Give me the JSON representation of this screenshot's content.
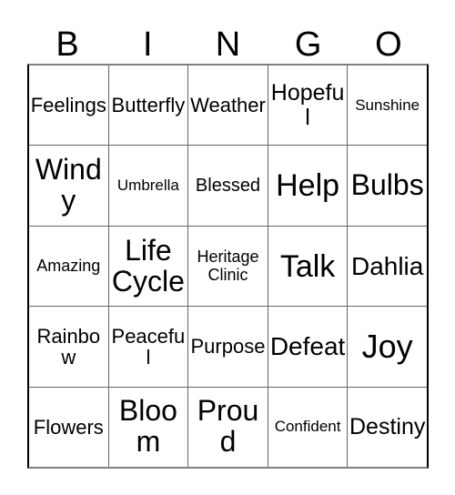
{
  "card": {
    "title": "BINGO",
    "header": {
      "letters": [
        {
          "label": "B"
        },
        {
          "label": "I"
        },
        {
          "label": "N"
        },
        {
          "label": "G"
        },
        {
          "label": "O"
        }
      ]
    },
    "grid": {
      "columns": 5,
      "rows": 5,
      "border_color": "#666666",
      "outer_border_color": "#000000",
      "background_color": "#ffffff",
      "text_color": "#000000",
      "cells": [
        [
          {
            "text": "Feelings",
            "size": "fs-m"
          },
          {
            "text": "Butterfly",
            "size": "fs-m"
          },
          {
            "text": "Weather",
            "size": "fs-m"
          },
          {
            "text": "Hopeful",
            "size": "fs-ml"
          },
          {
            "text": "Sunshine",
            "size": "fs-xs"
          }
        ],
        [
          {
            "text": "Windy",
            "size": "fs-xl"
          },
          {
            "text": "Umbrella",
            "size": "fs-xs"
          },
          {
            "text": "Blessed",
            "size": "fs-sm"
          },
          {
            "text": "Help",
            "size": "fs-xxl"
          },
          {
            "text": "Bulbs",
            "size": "fs-xl"
          }
        ],
        [
          {
            "text": "Amazing",
            "size": "fs-s"
          },
          {
            "text": "Life Cycle",
            "size": "fs-xl"
          },
          {
            "text": "Heritage Clinic",
            "size": "fs-s"
          },
          {
            "text": "Talk",
            "size": "fs-xxl"
          },
          {
            "text": "Dahlia",
            "size": "fs-l"
          }
        ],
        [
          {
            "text": "Rainbow",
            "size": "fs-m"
          },
          {
            "text": "Peaceful",
            "size": "fs-m"
          },
          {
            "text": "Purpose",
            "size": "fs-m"
          },
          {
            "text": "Defeat",
            "size": "fs-l"
          },
          {
            "text": "Joy",
            "size": "fs-xxxl"
          }
        ],
        [
          {
            "text": "Flowers",
            "size": "fs-m"
          },
          {
            "text": "Bloom",
            "size": "fs-xl"
          },
          {
            "text": "Proud",
            "size": "fs-xl"
          },
          {
            "text": "Confident",
            "size": "fs-xs"
          },
          {
            "text": "Destiny",
            "size": "fs-ml"
          }
        ]
      ]
    }
  }
}
